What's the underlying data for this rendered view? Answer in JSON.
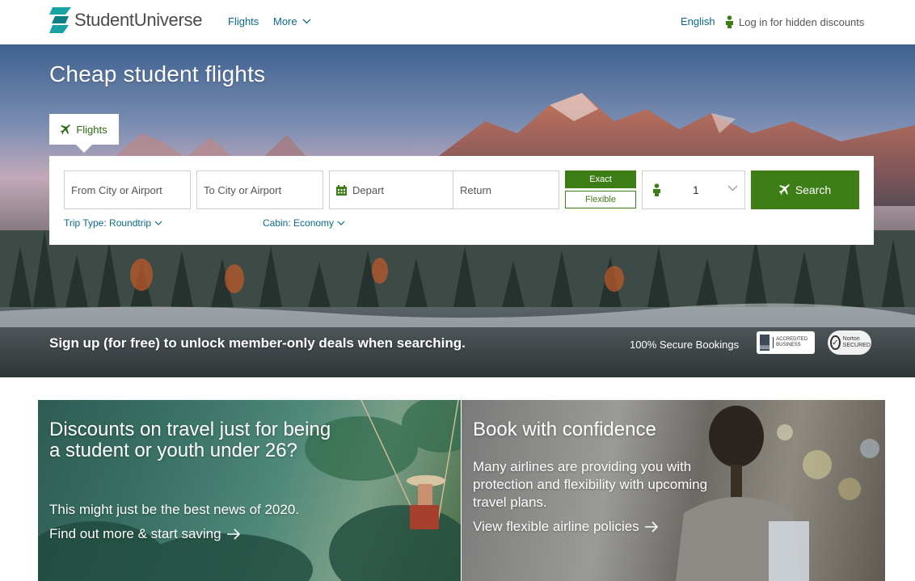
{
  "header": {
    "brand": "StudentUniverse",
    "nav": {
      "flights": "Flights",
      "more": "More"
    },
    "language": "English",
    "login": "Log in for hidden discounts"
  },
  "hero": {
    "title": "Cheap student flights",
    "tab_flights": "Flights",
    "search": {
      "from_placeholder": "From City or Airport",
      "to_placeholder": "To City or Airport",
      "depart_placeholder": "Depart",
      "return_placeholder": "Return",
      "exact": "Exact",
      "flexible": "Flexible",
      "passengers": "1",
      "search_button": "Search",
      "trip_type": "Trip Type: Roundtrip",
      "cabin": "Cabin: Economy"
    },
    "signup": "Sign up (for free) to unlock member-only deals when searching.",
    "secure": "100% Secure Bookings",
    "bbb_badge": "ACCREDITED BUSINESS",
    "norton_badge": "Norton SECURED"
  },
  "cards": {
    "discounts": {
      "title": "Discounts on travel just for being a student or youth under 26?",
      "body": "This might just be the best news of 2020.",
      "link": "Find out more & start saving"
    },
    "confidence": {
      "title": "Book with confidence",
      "body": "Many airlines are providing you with protection and flexibility with upcoming travel plans.",
      "link": "View flexible airline policies"
    }
  },
  "colors": {
    "brand_teal": "#1fa3a3",
    "accent_green": "#3c7d16",
    "link_blue": "#0a6a8a"
  }
}
